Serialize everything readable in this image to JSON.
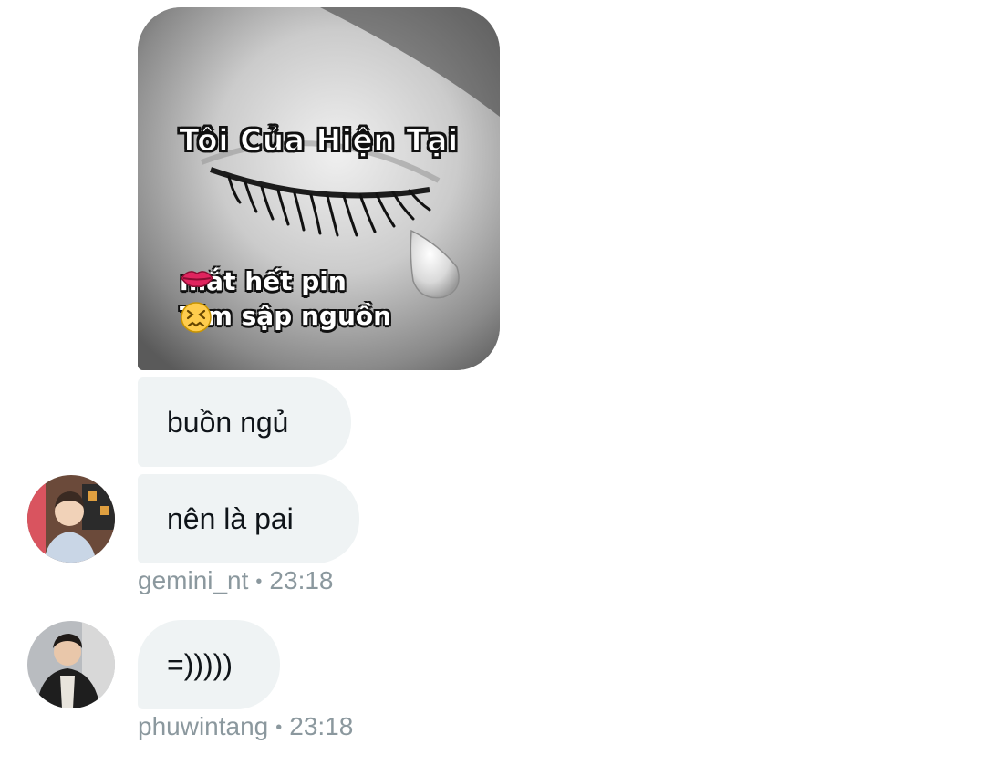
{
  "image_message": {
    "title": "Tôi Của Hiện Tại",
    "line1": "mắt hết pin",
    "line2": "Tim sập nguồn",
    "emoji1": "kiss-mark",
    "emoji2": "confounded-face"
  },
  "messages": [
    {
      "text": "buồn ngủ"
    },
    {
      "text": "nên là pai"
    },
    {
      "text": "=)))))"
    }
  ],
  "meta": [
    {
      "username": "gemini_nt",
      "separator": "•",
      "time": "23:18"
    },
    {
      "username": "phuwintang",
      "separator": "•",
      "time": "23:18"
    }
  ],
  "colors": {
    "bubble": "#eff3f4",
    "meta_text": "#8b989e",
    "text": "#0f1419"
  }
}
